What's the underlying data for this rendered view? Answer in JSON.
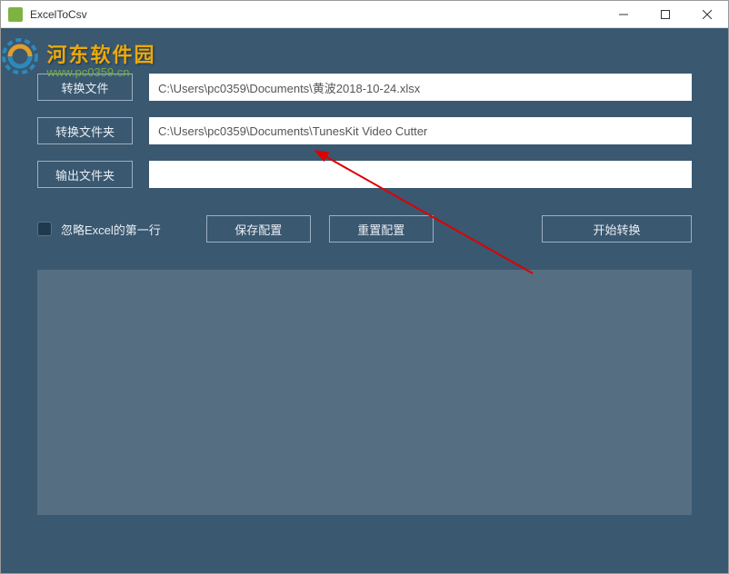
{
  "window": {
    "title": "ExcelToCsv"
  },
  "watermark": {
    "text": "河东软件园",
    "url": "www.pc0359.cn"
  },
  "form": {
    "convert_file_label": "转换文件",
    "convert_file_value": "C:\\Users\\pc0359\\Documents\\黄波2018-10-24.xlsx",
    "convert_folder_label": "转换文件夹",
    "convert_folder_value": "C:\\Users\\pc0359\\Documents\\TunesKit Video Cutter",
    "output_folder_label": "输出文件夹",
    "output_folder_value": ""
  },
  "options": {
    "ignore_first_row_label": "忽略Excel的第一行"
  },
  "buttons": {
    "save_config": "保存配置",
    "reset_config": "重置配置",
    "start_convert": "开始转换"
  }
}
